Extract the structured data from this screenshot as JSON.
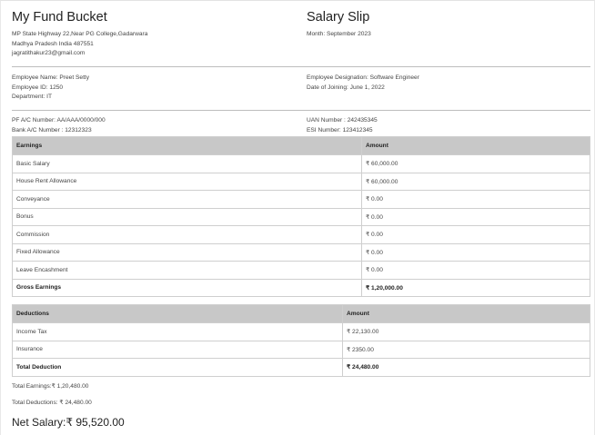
{
  "company": {
    "name": "My Fund Bucket",
    "address_line1": "MP State Highway 22,Near PG College,Gadarwara",
    "address_line2": "Madhya Pradesh India 487551",
    "email": "jagratithakur23@gmail.com"
  },
  "slip": {
    "title": "Salary Slip",
    "month": "Month: September 2023"
  },
  "employee": {
    "name": "Employee Name: Preet Setty",
    "id": "Employee ID: 1250",
    "department": "Department: IT",
    "designation": "Employee Designation: Software Engineer",
    "joining": "Date of Joining: June 1, 2022"
  },
  "accounts": {
    "pf": "PF A/C Number: AA/AAA/0000/000",
    "bank": "Bank A/C Number : 12312323",
    "uan": "UAN Number : 242435345",
    "esi": "ESI Number: 123412345"
  },
  "earnings": {
    "header_label": "Earnings",
    "header_amount": "Amount",
    "rows": [
      {
        "label": "Basic Salary",
        "amount": "₹ 60,000.00"
      },
      {
        "label": "House Rent Allowance",
        "amount": "₹ 60,000.00"
      },
      {
        "label": "Conveyance",
        "amount": "₹ 0.00"
      },
      {
        "label": "Bonus",
        "amount": "₹ 0.00"
      },
      {
        "label": "Commission",
        "amount": "₹ 0.00"
      },
      {
        "label": "Fixed Allowance",
        "amount": "₹ 0.00"
      },
      {
        "label": "Leave Encashment",
        "amount": "₹ 0.00"
      }
    ],
    "total_label": "Gross Earnings",
    "total_amount": "₹ 1,20,000.00"
  },
  "deductions": {
    "header_label": "Deductions",
    "header_amount": "Amount",
    "rows": [
      {
        "label": "Income Tax",
        "amount": "₹ 22,130.00"
      },
      {
        "label": "Insurance",
        "amount": "₹ 2350.00"
      }
    ],
    "total_label": "Total Deduction",
    "total_amount": "₹ 24,480.00"
  },
  "summary": {
    "total_earnings": "Total Earnings:₹ 1,20,480.00",
    "total_deductions": "Total Deductions: ₹ 24,480.00",
    "net_salary": "Net Salary:₹ 95,520.00"
  }
}
